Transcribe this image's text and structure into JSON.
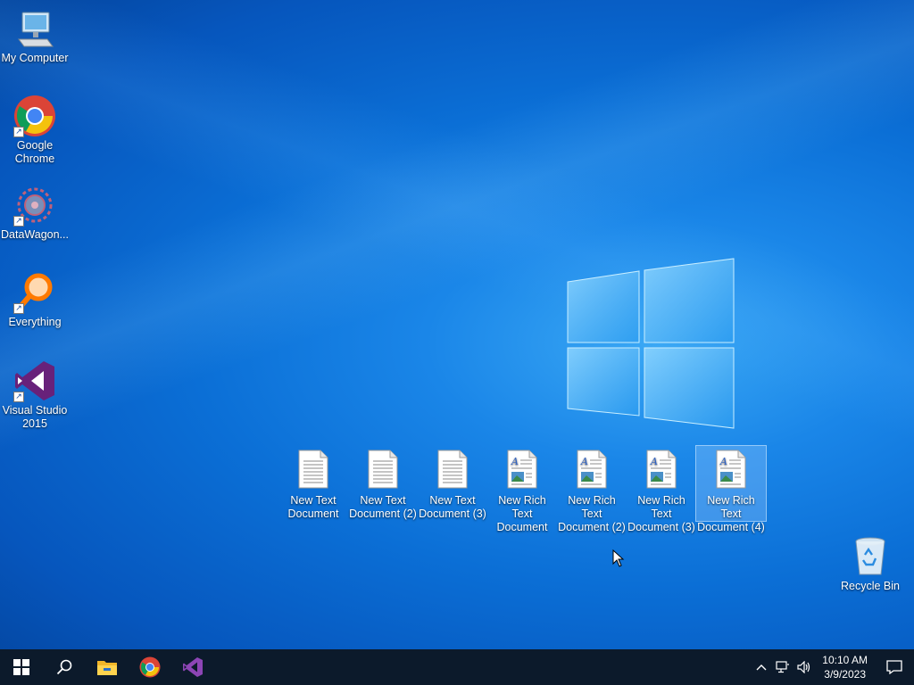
{
  "desktop": {
    "left_icons": [
      {
        "label": "My Computer",
        "icon": "my-computer-icon"
      },
      {
        "label": "Google Chrome",
        "icon": "chrome-icon"
      },
      {
        "label": "DataWagon...",
        "icon": "datawagon-icon"
      },
      {
        "label": "Everything",
        "icon": "everything-search-icon"
      },
      {
        "label": "Visual Studio 2015",
        "icon": "visual-studio-icon"
      }
    ],
    "files": [
      {
        "label": "New Text Document",
        "icon": "text-document-icon"
      },
      {
        "label": "New Text Document (2)",
        "icon": "text-document-icon"
      },
      {
        "label": "New Text Document (3)",
        "icon": "text-document-icon"
      },
      {
        "label": "New Rich Text Document",
        "icon": "rich-text-document-icon"
      },
      {
        "label": "New Rich Text Document (2)",
        "icon": "rich-text-document-icon"
      },
      {
        "label": "New Rich Text Document (3)",
        "icon": "rich-text-document-icon"
      },
      {
        "label": "New Rich Text Document (4)",
        "icon": "rich-text-document-icon",
        "selected": true
      }
    ],
    "recycle_bin": {
      "label": "Recycle Bin",
      "icon": "recycle-bin-icon"
    }
  },
  "taskbar": {
    "pinned": [
      "start-icon",
      "search-icon",
      "file-explorer-icon",
      "chrome-icon",
      "visual-studio-icon"
    ],
    "tray": {
      "time": "10:10 AM",
      "date": "3/9/2023"
    }
  },
  "colors": {
    "taskbar_bg": "#0c1a2b",
    "desktop_blue": "#0b6fd6",
    "chrome_red": "#db4437",
    "chrome_yellow": "#f4c20d",
    "chrome_green": "#0f9d58",
    "chrome_blue": "#4285f4",
    "vs_purple": "#68217a"
  }
}
